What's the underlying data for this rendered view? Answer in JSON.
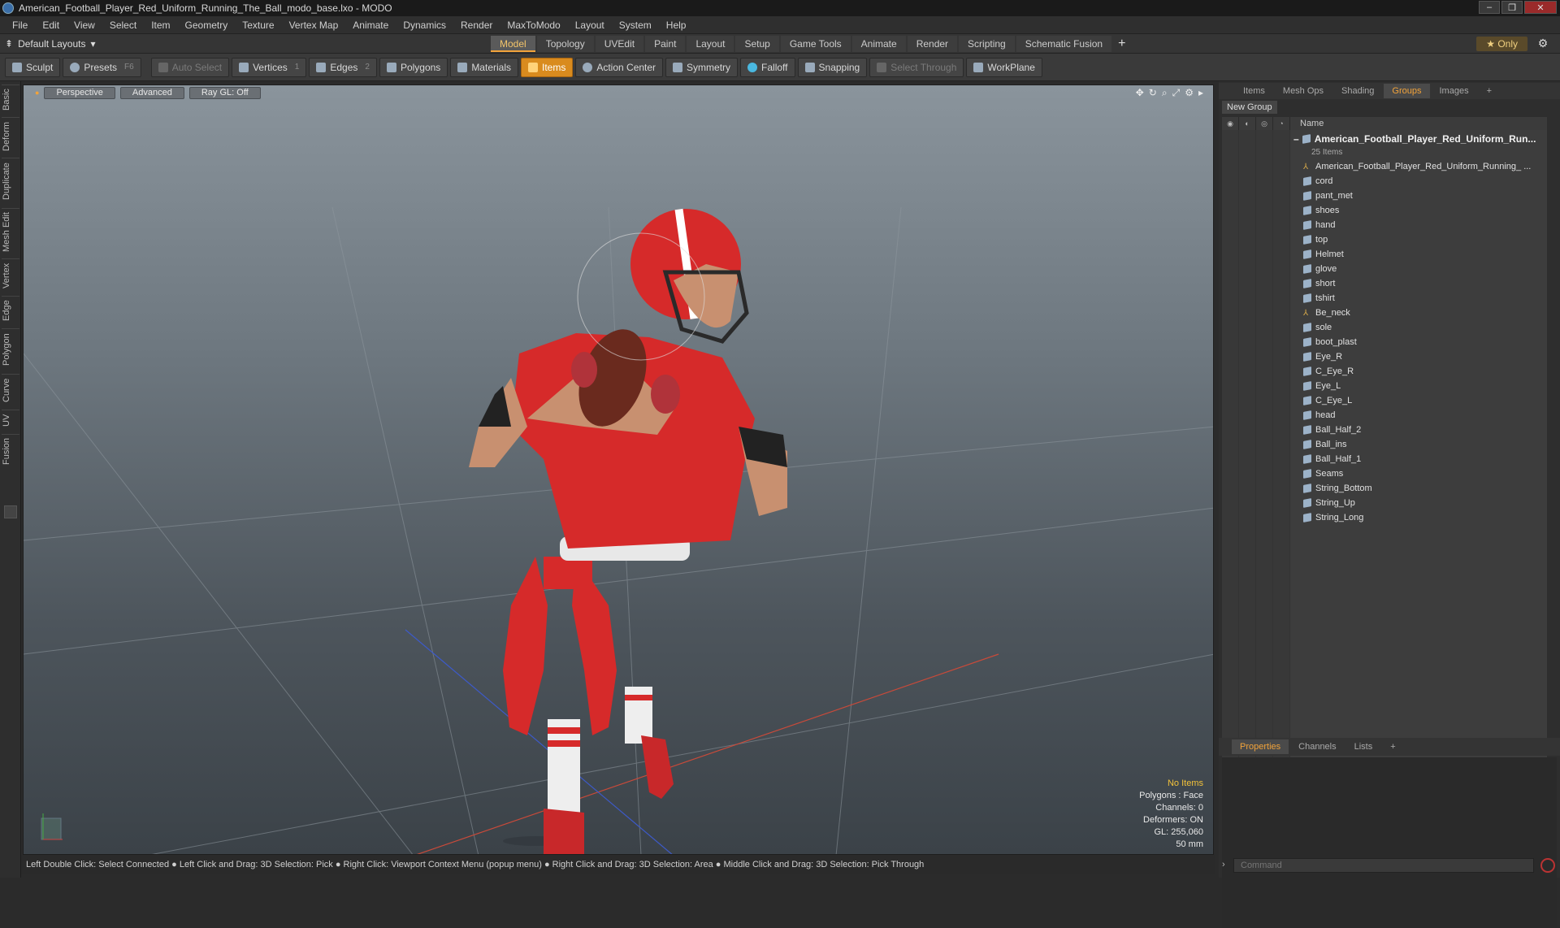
{
  "window": {
    "title": "American_Football_Player_Red_Uniform_Running_The_Ball_modo_base.lxo - MODO"
  },
  "menu": [
    "File",
    "Edit",
    "View",
    "Select",
    "Item",
    "Geometry",
    "Texture",
    "Vertex Map",
    "Animate",
    "Dynamics",
    "Render",
    "MaxToModo",
    "Layout",
    "System",
    "Help"
  ],
  "layout": {
    "selector": "Default Layouts",
    "tabs": [
      "Model",
      "Topology",
      "UVEdit",
      "Paint",
      "Layout",
      "Setup",
      "Game Tools",
      "Animate",
      "Render",
      "Scripting",
      "Schematic Fusion"
    ],
    "active_tab": "Model",
    "only_label": "Only"
  },
  "toolbar": {
    "sculpt": "Sculpt",
    "presets": "Presets",
    "presets_key": "F6",
    "auto_select": "Auto Select",
    "vertices": "Vertices",
    "vertices_count": "1",
    "edges": "Edges",
    "edges_count": "2",
    "polygons": "Polygons",
    "materials": "Materials",
    "items": "Items",
    "action_center": "Action Center",
    "symmetry": "Symmetry",
    "falloff": "Falloff",
    "snapping": "Snapping",
    "select_through": "Select Through",
    "workplane": "WorkPlane"
  },
  "left_tabs": [
    "Basic",
    "Deform",
    "Duplicate",
    "Mesh Edit",
    "Vertex",
    "Edge",
    "Polygon",
    "Curve",
    "UV",
    "Fusion"
  ],
  "viewport": {
    "perspective": "Perspective",
    "advanced": "Advanced",
    "raygl": "Ray GL: Off",
    "hud": {
      "no_items": "No Items",
      "polygons": "Polygons : Face",
      "channels": "Channels: 0",
      "deformers": "Deformers: ON",
      "gl": "GL: 255,060",
      "focal": "50 mm"
    }
  },
  "statusbar": "Left Double Click: Select Connected ● Left Click and Drag: 3D Selection: Pick ● Right Click: Viewport Context Menu (popup menu) ● Right Click and Drag: 3D Selection: Area ● Middle Click and Drag: 3D Selection: Pick Through",
  "right_panel": {
    "tabs": [
      "Items",
      "Mesh Ops",
      "Shading",
      "Groups",
      "Images"
    ],
    "active_tab": "Groups",
    "new_group": "New Group",
    "name_header": "Name",
    "group_name": "American_Football_Player_Red_Uniform_Run...",
    "group_count": "25 Items",
    "items": [
      {
        "name": "American_Football_Player_Red_Uniform_Running_ ...",
        "type": "locator"
      },
      {
        "name": "cord",
        "type": "mesh"
      },
      {
        "name": "pant_met",
        "type": "mesh"
      },
      {
        "name": "shoes",
        "type": "mesh"
      },
      {
        "name": "hand",
        "type": "mesh"
      },
      {
        "name": "top",
        "type": "mesh"
      },
      {
        "name": "Helmet",
        "type": "mesh"
      },
      {
        "name": "glove",
        "type": "mesh"
      },
      {
        "name": "short",
        "type": "mesh"
      },
      {
        "name": "tshirt",
        "type": "mesh"
      },
      {
        "name": "Be_neck",
        "type": "locator"
      },
      {
        "name": "sole",
        "type": "mesh"
      },
      {
        "name": "boot_plast",
        "type": "mesh"
      },
      {
        "name": "Eye_R",
        "type": "mesh"
      },
      {
        "name": "C_Eye_R",
        "type": "mesh"
      },
      {
        "name": "Eye_L",
        "type": "mesh"
      },
      {
        "name": "C_Eye_L",
        "type": "mesh"
      },
      {
        "name": "head",
        "type": "mesh"
      },
      {
        "name": "Ball_Half_2",
        "type": "mesh"
      },
      {
        "name": "Ball_ins",
        "type": "mesh"
      },
      {
        "name": "Ball_Half_1",
        "type": "mesh"
      },
      {
        "name": "Seams",
        "type": "mesh"
      },
      {
        "name": "String_Bottom",
        "type": "mesh"
      },
      {
        "name": "String_Up",
        "type": "mesh"
      },
      {
        "name": "String_Long",
        "type": "mesh"
      }
    ],
    "bottom_tabs": [
      "Properties",
      "Channels",
      "Lists"
    ],
    "bottom_active": "Properties",
    "command_placeholder": "Command"
  },
  "colors": {
    "accent": "#f2a33a",
    "uniform_red": "#d62a2a"
  }
}
